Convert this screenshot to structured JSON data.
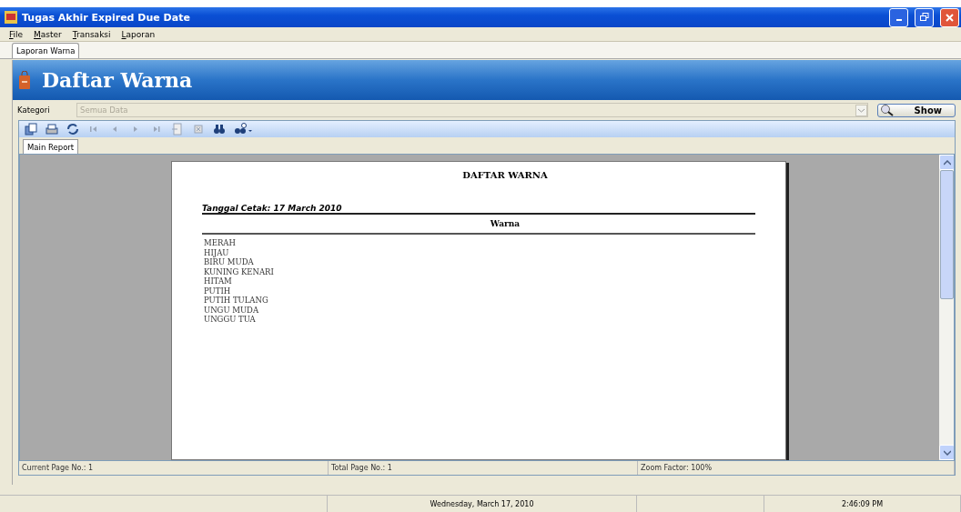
{
  "window": {
    "title": "Tugas Akhir Expired Due Date"
  },
  "menu": [
    "File",
    "Master",
    "Transaksi",
    "Laporan"
  ],
  "tabs": [
    {
      "label": "Laporan Warna",
      "selected": true
    }
  ],
  "header": {
    "title": "Daftar Warna"
  },
  "filter": {
    "label": "Kategori",
    "placeholder": "Semua Data",
    "disabled": true,
    "button": "Show"
  },
  "toolbar": [
    {
      "kind": "export",
      "disabled": false
    },
    {
      "kind": "print",
      "disabled": false
    },
    {
      "kind": "refresh",
      "disabled": false
    },
    {
      "kind": "first",
      "disabled": true
    },
    {
      "kind": "prev",
      "disabled": true
    },
    {
      "kind": "next",
      "disabled": true
    },
    {
      "kind": "last",
      "disabled": true
    },
    {
      "kind": "goto",
      "disabled": true
    },
    {
      "kind": "stop",
      "disabled": true
    },
    {
      "kind": "find",
      "disabled": false
    },
    {
      "kind": "zoom",
      "disabled": false
    }
  ],
  "report_tabs": [
    {
      "label": "Main Report",
      "selected": true
    }
  ],
  "report": {
    "title": "DAFTAR WARNA",
    "date": "Tanggal Cetak: 17 March 2010",
    "column": "Warna",
    "rows": [
      "MERAH",
      "HIJAU",
      "BIRU MUDA",
      "KUNING KENARI",
      "HITAM",
      "PUTIH",
      "PUTIH TULANG",
      "UNGU MUDA",
      "UNGGU TUA"
    ]
  },
  "viewer_status": [
    "Current Page No.: 1",
    "Total Page No.: 1",
    "Zoom Factor: 100%"
  ],
  "status_bar": {
    "date": "Wednesday, March 17, 2010",
    "time": "2:46:09 PM"
  }
}
